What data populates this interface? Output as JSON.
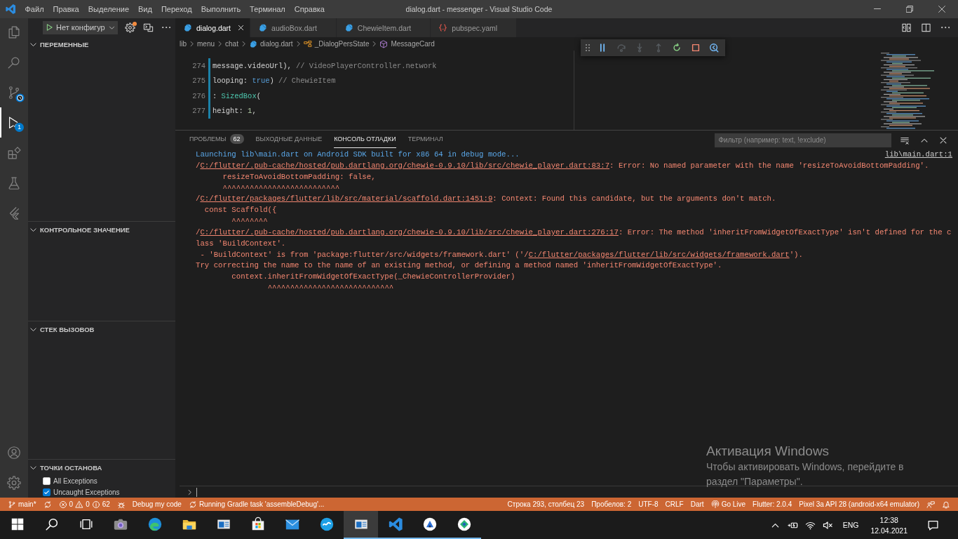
{
  "title_bar": {
    "menu": [
      "Файл",
      "Правка",
      "Выделение",
      "Вид",
      "Переход",
      "Выполнить",
      "Терминал",
      "Справка"
    ],
    "title": "dialog.dart - messenger - Visual Studio Code",
    "controls": [
      {
        "kind": "minimize"
      },
      {
        "kind": "restore"
      },
      {
        "kind": "close"
      }
    ]
  },
  "activity_bar": {
    "items": [
      {
        "kind": "explorer",
        "selected": false,
        "busy": false
      },
      {
        "kind": "search",
        "selected": false,
        "busy": false
      },
      {
        "kind": "source-control",
        "selected": false,
        "busy": true
      },
      {
        "kind": "run-debug",
        "selected": true,
        "busy": false,
        "badge": "1"
      },
      {
        "kind": "extensions",
        "selected": false,
        "busy": false
      },
      {
        "kind": "testing",
        "selected": false,
        "busy": false
      },
      {
        "kind": "flutter",
        "selected": false,
        "busy": false
      }
    ],
    "bottom": [
      {
        "kind": "account"
      },
      {
        "kind": "settings"
      }
    ]
  },
  "sidebar": {
    "config": "Нет конфигур",
    "actions": [
      {
        "kind": "settings",
        "dot": true
      },
      {
        "kind": "console",
        "dot": false
      },
      {
        "kind": "more",
        "dot": false
      }
    ],
    "sections": [
      {
        "title": "ПЕРЕМЕННЫЕ",
        "expanded": true
      },
      {
        "title": "КОНТРОЛЬНОЕ ЗНАЧЕНИЕ",
        "expanded": true
      },
      {
        "title": "СТЕК ВЫЗОВОВ",
        "expanded": true
      },
      {
        "title": "ТОЧКИ ОСТАНОВА",
        "expanded": true,
        "items": [
          {
            "label": "All Exceptions",
            "checked": false
          },
          {
            "label": "Uncaught Exceptions",
            "checked": true
          }
        ]
      }
    ]
  },
  "editor": {
    "tabs": [
      {
        "label": "dialog.dart",
        "kind": "dart",
        "selected": true
      },
      {
        "label": "audioBox.dart",
        "kind": "dart",
        "selected": false
      },
      {
        "label": "ChewieItem.dart",
        "kind": "dart",
        "selected": false
      },
      {
        "label": "pubspec.yaml",
        "kind": "yaml",
        "selected": false
      }
    ],
    "actions": [
      {
        "kind": "compare"
      },
      {
        "kind": "split"
      },
      {
        "kind": "more"
      }
    ],
    "breadcrumbs": [
      {
        "label": "lib",
        "kind": "folder"
      },
      {
        "label": "menu",
        "kind": "folder"
      },
      {
        "label": "chat",
        "kind": "folder"
      },
      {
        "label": "dialog.dart",
        "kind": "dart"
      },
      {
        "label": "_DialogPersState",
        "kind": "class"
      },
      {
        "label": "MessageCard",
        "kind": "method"
      }
    ],
    "lines": [
      {
        "number": "274",
        "modified": true,
        "tokens": [
          {
            "text": "                                message.videoUrl), ",
            "kind": "plain"
          },
          {
            "text": "// VideoPlayerController.network",
            "kind": "comment"
          }
        ]
      },
      {
        "number": "275",
        "modified": true,
        "tokens": [
          {
            "text": "                        looping: ",
            "kind": "plain"
          },
          {
            "text": "true",
            "kind": "keyword"
          },
          {
            "text": ") ",
            "kind": "plain"
          },
          {
            "text": "// ChewieItem",
            "kind": "comment"
          }
        ]
      },
      {
        "number": "276",
        "modified": true,
        "tokens": [
          {
            "text": "                    : ",
            "kind": "plain"
          },
          {
            "text": "SizedBox",
            "kind": "type"
          },
          {
            "text": "(",
            "kind": "plain"
          }
        ]
      },
      {
        "number": "277",
        "modified": true,
        "tokens": [
          {
            "text": "                        height: ",
            "kind": "plain"
          },
          {
            "text": "1",
            "kind": "number"
          },
          {
            "text": ",",
            "kind": "plain"
          }
        ]
      }
    ],
    "debug_toolbar": [
      {
        "kind": "pause",
        "disabled": false
      },
      {
        "kind": "step-over",
        "disabled": true
      },
      {
        "kind": "step-into",
        "disabled": true
      },
      {
        "kind": "step-out",
        "disabled": true
      },
      {
        "kind": "restart",
        "disabled": false
      },
      {
        "kind": "stop",
        "disabled": false
      },
      {
        "kind": "devtools",
        "disabled": false
      }
    ]
  },
  "panel": {
    "tabs": [
      {
        "label": "ПРОБЛЕМЫ",
        "selected": false,
        "badge": "62"
      },
      {
        "label": "ВЫХОДНЫЕ ДАННЫЕ",
        "selected": false
      },
      {
        "label": "КОНСОЛЬ ОТЛАДКИ",
        "selected": true
      },
      {
        "label": "ТЕРМИНАЛ",
        "selected": false
      }
    ],
    "filter": {
      "placeholder": "Фильтр (например: text, !exclude)"
    },
    "actions": [
      {
        "kind": "clear"
      },
      {
        "kind": "collapse"
      },
      {
        "kind": "close"
      }
    ],
    "console": [
      {
        "kind": "info",
        "parts": [
          {
            "text": "Launching lib\\main.dart on Android SDK built for x86 64 in debug mode...",
            "link": false
          }
        ],
        "source": "lib\\main.dart:1"
      },
      {
        "kind": "error",
        "parts": [
          {
            "text": "/",
            "link": false
          },
          {
            "text": "C:/flutter/.pub-cache/hosted/pub.dartlang.org/chewie-0.9.10/lib/src/chewie_player.dart:83:7",
            "link": true
          },
          {
            "text": ": Error: No named parameter with the name 'resizeToAvoidBottomPadding'.",
            "link": false
          }
        ]
      },
      {
        "kind": "error",
        "parts": [
          {
            "text": "      resizeToAvoidBottomPadding: false,",
            "link": false
          }
        ]
      },
      {
        "kind": "error",
        "parts": [
          {
            "text": "      ^^^^^^^^^^^^^^^^^^^^^^^^^^",
            "link": false
          }
        ]
      },
      {
        "kind": "error",
        "parts": [
          {
            "text": "/",
            "link": false
          },
          {
            "text": "C:/flutter/packages/flutter/lib/src/material/scaffold.dart:1451:9",
            "link": true
          },
          {
            "text": ": Context: Found this candidate, but the arguments don't match.",
            "link": false
          }
        ]
      },
      {
        "kind": "error",
        "parts": [
          {
            "text": "  const Scaffold({",
            "link": false
          }
        ]
      },
      {
        "kind": "error",
        "parts": [
          {
            "text": "        ^^^^^^^^",
            "link": false
          }
        ]
      },
      {
        "kind": "error",
        "parts": [
          {
            "text": "/",
            "link": false
          },
          {
            "text": "C:/flutter/.pub-cache/hosted/pub.dartlang.org/chewie-0.9.10/lib/src/chewie_player.dart:276:17",
            "link": true
          },
          {
            "text": ": Error: The method 'inheritFromWidgetOfExactType' isn't defined for the c",
            "link": false
          }
        ]
      },
      {
        "kind": "error",
        "parts": [
          {
            "text": "lass 'BuildContext'.",
            "link": false
          }
        ]
      },
      {
        "kind": "error",
        "parts": [
          {
            "text": " - 'BuildContext' is from 'package:flutter/src/widgets/framework.dart' ('/",
            "link": false
          },
          {
            "text": "C:/flutter/packages/flutter/lib/src/widgets/framework.dart",
            "link": true
          },
          {
            "text": "').",
            "link": false
          }
        ]
      },
      {
        "kind": "error",
        "parts": [
          {
            "text": "Try correcting the name to the name of an existing method, or defining a method named 'inheritFromWidgetOfExactType'.",
            "link": false
          }
        ]
      },
      {
        "kind": "error",
        "parts": [
          {
            "text": "        context.inheritFromWidgetOfExactType(_ChewieControllerProvider)",
            "link": false
          }
        ]
      },
      {
        "kind": "error",
        "parts": [
          {
            "text": "                ^^^^^^^^^^^^^^^^^^^^^^^^^^^^",
            "link": false
          }
        ]
      }
    ]
  },
  "activation_notice": {
    "title": "Активация Windows",
    "lines": [
      "Чтобы активировать Windows, перейдите в",
      "раздел \"Параметры\"."
    ]
  },
  "status_bar": {
    "left": [
      {
        "kind": "branch",
        "label": "main*"
      },
      {
        "kind": "sync"
      },
      {
        "kind": "problems",
        "errors": "0",
        "warnings": "0",
        "infos": "62"
      },
      {
        "kind": "debug"
      },
      {
        "kind": "text",
        "label": "Debug my code"
      },
      {
        "kind": "progress",
        "label": "Running Gradle task 'assembleDebug'..."
      }
    ],
    "right": [
      {
        "kind": "text",
        "label": "Строка 293, столбец 23"
      },
      {
        "kind": "text",
        "label": "Пробелов: 2"
      },
      {
        "kind": "text",
        "label": "UTF-8"
      },
      {
        "kind": "text",
        "label": "CRLF"
      },
      {
        "kind": "text",
        "label": "Dart"
      },
      {
        "kind": "live",
        "label": "Go Live"
      },
      {
        "kind": "text",
        "label": "Flutter: 2.0.4"
      },
      {
        "kind": "text",
        "label": "Pixel 3a API 28 (android-x64 emulator)"
      },
      {
        "kind": "feedback"
      },
      {
        "kind": "bell"
      }
    ]
  },
  "taskbar": {
    "apps": [
      {
        "kind": "start",
        "running": false,
        "selected": false
      },
      {
        "kind": "search",
        "running": false,
        "selected": false
      },
      {
        "kind": "task-view",
        "running": false,
        "selected": false
      },
      {
        "kind": "camera",
        "running": false,
        "selected": false
      },
      {
        "kind": "browser",
        "running": false,
        "selected": false
      },
      {
        "kind": "files",
        "running": false,
        "selected": false
      },
      {
        "kind": "window",
        "running": false,
        "selected": false
      },
      {
        "kind": "store",
        "running": false,
        "selected": false
      },
      {
        "kind": "mail",
        "running": false,
        "selected": false
      },
      {
        "kind": "messenger",
        "running": false,
        "selected": false
      },
      {
        "kind": "window",
        "running": true,
        "selected": true
      },
      {
        "kind": "code",
        "running": true,
        "selected": false
      },
      {
        "kind": "disc-triangle",
        "running": true,
        "selected": false
      },
      {
        "kind": "disc-diamond",
        "running": true,
        "selected": false
      }
    ],
    "tray": [
      {
        "kind": "overflow"
      },
      {
        "kind": "power"
      },
      {
        "kind": "wifi"
      },
      {
        "kind": "volume-muted"
      },
      {
        "kind": "language",
        "label": "ENG"
      },
      {
        "kind": "clock",
        "time": "12:38",
        "date": "12.04.2021"
      },
      {
        "kind": "notifications"
      }
    ]
  }
}
